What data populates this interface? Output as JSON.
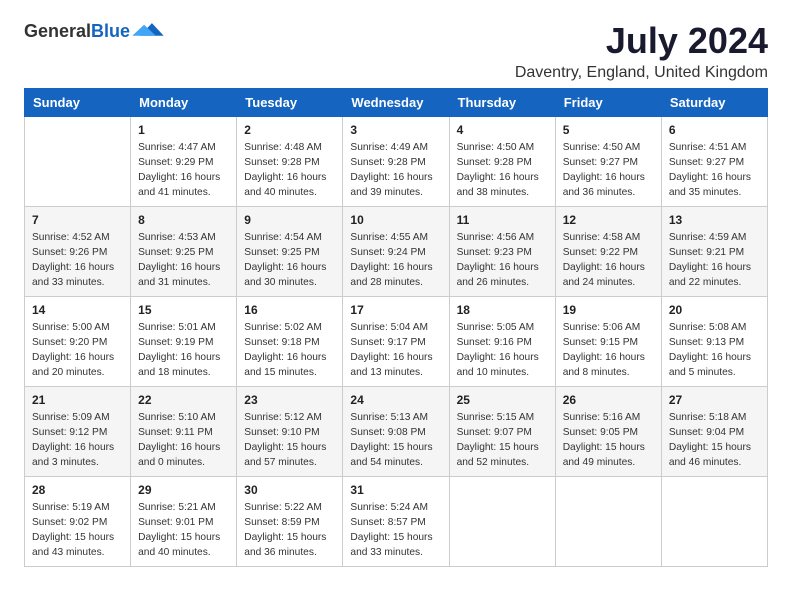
{
  "logo": {
    "general": "General",
    "blue": "Blue"
  },
  "title": "July 2024",
  "subtitle": "Daventry, England, United Kingdom",
  "days_of_week": [
    "Sunday",
    "Monday",
    "Tuesday",
    "Wednesday",
    "Thursday",
    "Friday",
    "Saturday"
  ],
  "weeks": [
    [
      {
        "day": "",
        "info": ""
      },
      {
        "day": "1",
        "info": "Sunrise: 4:47 AM\nSunset: 9:29 PM\nDaylight: 16 hours\nand 41 minutes."
      },
      {
        "day": "2",
        "info": "Sunrise: 4:48 AM\nSunset: 9:28 PM\nDaylight: 16 hours\nand 40 minutes."
      },
      {
        "day": "3",
        "info": "Sunrise: 4:49 AM\nSunset: 9:28 PM\nDaylight: 16 hours\nand 39 minutes."
      },
      {
        "day": "4",
        "info": "Sunrise: 4:50 AM\nSunset: 9:28 PM\nDaylight: 16 hours\nand 38 minutes."
      },
      {
        "day": "5",
        "info": "Sunrise: 4:50 AM\nSunset: 9:27 PM\nDaylight: 16 hours\nand 36 minutes."
      },
      {
        "day": "6",
        "info": "Sunrise: 4:51 AM\nSunset: 9:27 PM\nDaylight: 16 hours\nand 35 minutes."
      }
    ],
    [
      {
        "day": "7",
        "info": "Sunrise: 4:52 AM\nSunset: 9:26 PM\nDaylight: 16 hours\nand 33 minutes."
      },
      {
        "day": "8",
        "info": "Sunrise: 4:53 AM\nSunset: 9:25 PM\nDaylight: 16 hours\nand 31 minutes."
      },
      {
        "day": "9",
        "info": "Sunrise: 4:54 AM\nSunset: 9:25 PM\nDaylight: 16 hours\nand 30 minutes."
      },
      {
        "day": "10",
        "info": "Sunrise: 4:55 AM\nSunset: 9:24 PM\nDaylight: 16 hours\nand 28 minutes."
      },
      {
        "day": "11",
        "info": "Sunrise: 4:56 AM\nSunset: 9:23 PM\nDaylight: 16 hours\nand 26 minutes."
      },
      {
        "day": "12",
        "info": "Sunrise: 4:58 AM\nSunset: 9:22 PM\nDaylight: 16 hours\nand 24 minutes."
      },
      {
        "day": "13",
        "info": "Sunrise: 4:59 AM\nSunset: 9:21 PM\nDaylight: 16 hours\nand 22 minutes."
      }
    ],
    [
      {
        "day": "14",
        "info": "Sunrise: 5:00 AM\nSunset: 9:20 PM\nDaylight: 16 hours\nand 20 minutes."
      },
      {
        "day": "15",
        "info": "Sunrise: 5:01 AM\nSunset: 9:19 PM\nDaylight: 16 hours\nand 18 minutes."
      },
      {
        "day": "16",
        "info": "Sunrise: 5:02 AM\nSunset: 9:18 PM\nDaylight: 16 hours\nand 15 minutes."
      },
      {
        "day": "17",
        "info": "Sunrise: 5:04 AM\nSunset: 9:17 PM\nDaylight: 16 hours\nand 13 minutes."
      },
      {
        "day": "18",
        "info": "Sunrise: 5:05 AM\nSunset: 9:16 PM\nDaylight: 16 hours\nand 10 minutes."
      },
      {
        "day": "19",
        "info": "Sunrise: 5:06 AM\nSunset: 9:15 PM\nDaylight: 16 hours\nand 8 minutes."
      },
      {
        "day": "20",
        "info": "Sunrise: 5:08 AM\nSunset: 9:13 PM\nDaylight: 16 hours\nand 5 minutes."
      }
    ],
    [
      {
        "day": "21",
        "info": "Sunrise: 5:09 AM\nSunset: 9:12 PM\nDaylight: 16 hours\nand 3 minutes."
      },
      {
        "day": "22",
        "info": "Sunrise: 5:10 AM\nSunset: 9:11 PM\nDaylight: 16 hours\nand 0 minutes."
      },
      {
        "day": "23",
        "info": "Sunrise: 5:12 AM\nSunset: 9:10 PM\nDaylight: 15 hours\nand 57 minutes."
      },
      {
        "day": "24",
        "info": "Sunrise: 5:13 AM\nSunset: 9:08 PM\nDaylight: 15 hours\nand 54 minutes."
      },
      {
        "day": "25",
        "info": "Sunrise: 5:15 AM\nSunset: 9:07 PM\nDaylight: 15 hours\nand 52 minutes."
      },
      {
        "day": "26",
        "info": "Sunrise: 5:16 AM\nSunset: 9:05 PM\nDaylight: 15 hours\nand 49 minutes."
      },
      {
        "day": "27",
        "info": "Sunrise: 5:18 AM\nSunset: 9:04 PM\nDaylight: 15 hours\nand 46 minutes."
      }
    ],
    [
      {
        "day": "28",
        "info": "Sunrise: 5:19 AM\nSunset: 9:02 PM\nDaylight: 15 hours\nand 43 minutes."
      },
      {
        "day": "29",
        "info": "Sunrise: 5:21 AM\nSunset: 9:01 PM\nDaylight: 15 hours\nand 40 minutes."
      },
      {
        "day": "30",
        "info": "Sunrise: 5:22 AM\nSunset: 8:59 PM\nDaylight: 15 hours\nand 36 minutes."
      },
      {
        "day": "31",
        "info": "Sunrise: 5:24 AM\nSunset: 8:57 PM\nDaylight: 15 hours\nand 33 minutes."
      },
      {
        "day": "",
        "info": ""
      },
      {
        "day": "",
        "info": ""
      },
      {
        "day": "",
        "info": ""
      }
    ]
  ]
}
